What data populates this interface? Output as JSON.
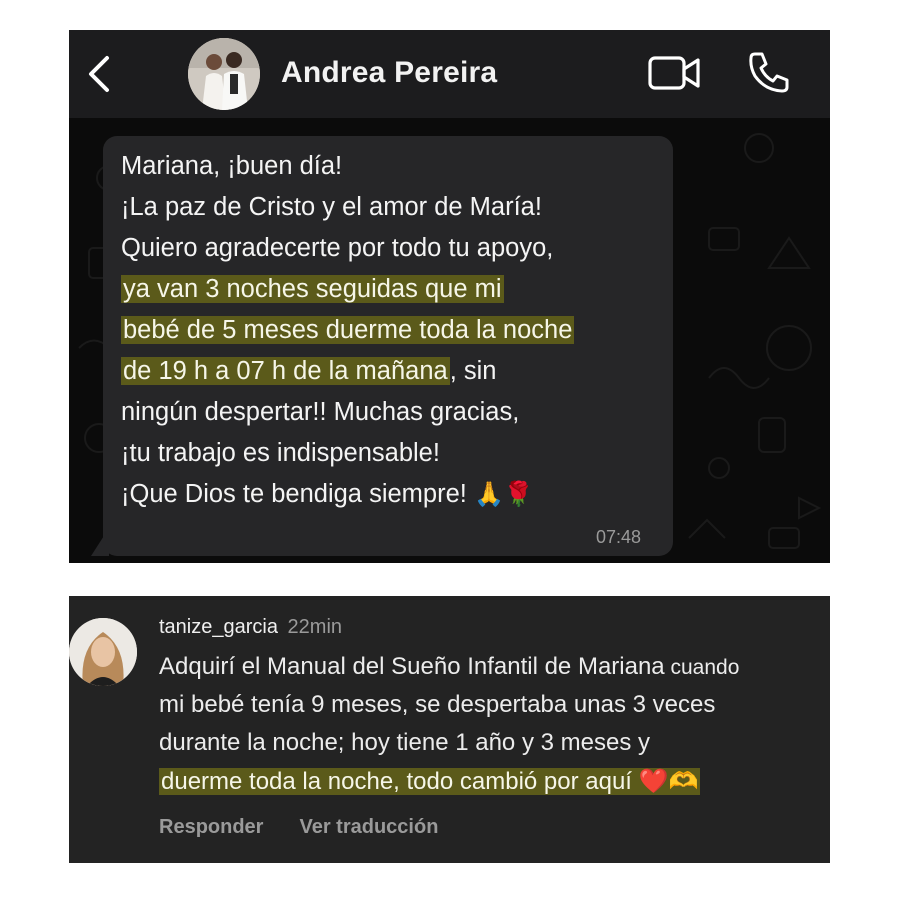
{
  "whatsapp": {
    "contact_name": "Andrea Pereira",
    "icons": {
      "back": "chevron-left-icon",
      "video": "video-camera-icon",
      "call": "phone-icon",
      "avatar": "contact-avatar"
    },
    "message": {
      "lines": [
        {
          "text": "Mariana, ¡buen día!"
        },
        {
          "text": "¡La paz de Cristo y el amor de María!"
        },
        {
          "text": "Quiero agradecerte por todo tu apoyo,"
        },
        {
          "highlight": "ya van 3 noches seguidas que mi"
        },
        {
          "highlight": "bebé de 5 meses duerme toda la noche"
        },
        {
          "highlight": "de 19 h a 07 h de la mañana",
          "text": ", sin"
        },
        {
          "text": "ningún despertar!! Muchas gracias,"
        },
        {
          "text": "¡tu trabajo es indispensable!"
        },
        {
          "text": "¡Que Dios te bendiga siempre! ",
          "emoji": "🙏🌹"
        }
      ],
      "time": "07:48"
    },
    "colors": {
      "header_bg": "#1c1c1e",
      "chat_bg": "#0b0b0b",
      "bubble_bg": "#262628",
      "highlight": "#5b5a1a"
    }
  },
  "instagram_comment": {
    "username": "tanize_garcia",
    "time": "22min",
    "lines": [
      {
        "text": "Adquirí el Manual del Sueño Infantil de Mariana",
        "small": " cuando"
      },
      {
        "text": "mi bebé tenía 9 meses, se despertaba unas 3 veces"
      },
      {
        "text": "durante la noche; hoy tiene 1 año y 3 meses y"
      },
      {
        "highlight": "duerme toda la noche, todo cambió por aquí ",
        "emoji": "❤️🫶"
      }
    ],
    "actions": {
      "reply": "Responder",
      "translate": "Ver traducción"
    },
    "colors": {
      "panel_bg": "#232323",
      "highlight": "#5b5a1a",
      "heart": "#e0241b",
      "hands": "#f5b800"
    }
  }
}
